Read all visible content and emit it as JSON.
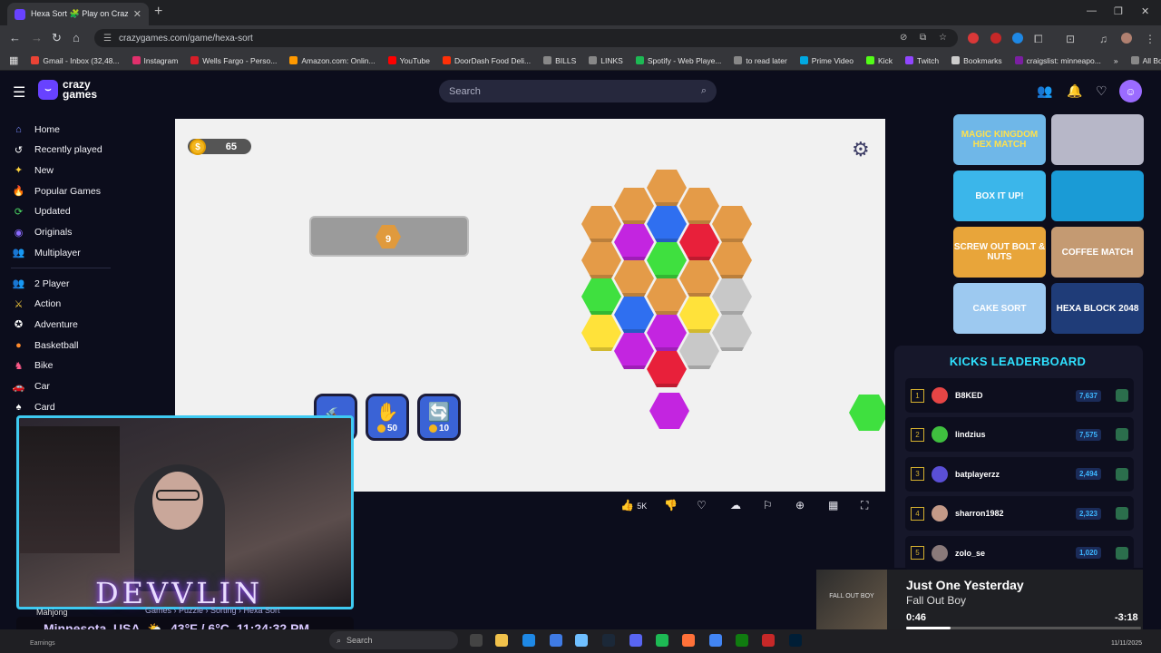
{
  "browser": {
    "tab_title": "Hexa Sort 🧩 Play on CrazyGames",
    "new_tab": "+",
    "url": "crazygames.com/game/hexa-sort",
    "bookmarks": [
      {
        "label": "Gmail - Inbox (32,48...",
        "color": "#ea4335"
      },
      {
        "label": "Instagram",
        "color": "#e1306c"
      },
      {
        "label": "Wells Fargo - Perso...",
        "color": "#d71e28"
      },
      {
        "label": "Amazon.com: Onlin...",
        "color": "#ff9900"
      },
      {
        "label": "YouTube",
        "color": "#ff0000"
      },
      {
        "label": "DoorDash Food Deli...",
        "color": "#ff3008"
      },
      {
        "label": "BILLS",
        "color": "#888888"
      },
      {
        "label": "LINKS",
        "color": "#888888"
      },
      {
        "label": "Spotify - Web Playe...",
        "color": "#1db954"
      },
      {
        "label": "to read later",
        "color": "#888888"
      },
      {
        "label": "Prime Video",
        "color": "#00a8e1"
      },
      {
        "label": "Kick",
        "color": "#53fc18"
      },
      {
        "label": "Twitch",
        "color": "#9146ff"
      },
      {
        "label": "Bookmarks",
        "color": "#cccccc"
      },
      {
        "label": "craigslist: minneapo...",
        "color": "#7b1fa2"
      }
    ],
    "all_bookmarks": "All Bookmarks"
  },
  "site": {
    "logo_icon": "⌣",
    "logo_line1": "crazy",
    "logo_line2": "games",
    "search_placeholder": "Search"
  },
  "sidebar": {
    "main": [
      {
        "label": "Home",
        "icon": "home-icon",
        "glyph": "⌂",
        "color": "#7a8cff"
      },
      {
        "label": "Recently played",
        "icon": "history-icon",
        "glyph": "↺",
        "color": "#ffffff"
      },
      {
        "label": "New",
        "icon": "sparkle-icon",
        "glyph": "✦",
        "color": "#ffd33d"
      },
      {
        "label": "Popular Games",
        "icon": "fire-icon",
        "glyph": "🔥",
        "color": "#ff6a2b"
      },
      {
        "label": "Updated",
        "icon": "refresh-icon",
        "glyph": "⟳",
        "color": "#4cd964"
      },
      {
        "label": "Originals",
        "icon": "originals-icon",
        "glyph": "◉",
        "color": "#8b6bff"
      },
      {
        "label": "Multiplayer",
        "icon": "multiplayer-icon",
        "glyph": "👥",
        "color": "#8b6bff"
      }
    ],
    "categories": [
      {
        "label": "2 Player",
        "icon": "two-player-icon",
        "glyph": "👥",
        "color": "#7a8cff"
      },
      {
        "label": "Action",
        "icon": "sword-icon",
        "glyph": "⚔",
        "color": "#ffd33d"
      },
      {
        "label": "Adventure",
        "icon": "compass-icon",
        "glyph": "✪",
        "color": "#ffffff"
      },
      {
        "label": "Basketball",
        "icon": "basketball-icon",
        "glyph": "●",
        "color": "#ff8a2b"
      },
      {
        "label": "Bike",
        "icon": "bike-icon",
        "glyph": "♞",
        "color": "#ff5a8a"
      },
      {
        "label": "Car",
        "icon": "car-icon",
        "glyph": "🚗",
        "color": "#ff4444"
      },
      {
        "label": "Card",
        "icon": "card-icon",
        "glyph": "♠",
        "color": "#ffffff"
      }
    ]
  },
  "game": {
    "coins": "65",
    "coin_symbol": "$",
    "unlock_count": "9",
    "boosters": [
      {
        "name": "hammer-booster",
        "icon": "🔨",
        "cost": "",
        "color": "#4a73e8"
      },
      {
        "name": "swap-booster",
        "icon": "✋",
        "cost": "50",
        "color": "#4a73e8"
      },
      {
        "name": "shuffle-booster",
        "icon": "🔄",
        "cost": "10",
        "color": "#4a73e8"
      }
    ]
  },
  "game_toolbar": {
    "likes": "5K"
  },
  "right_rail": {
    "thumbs": [
      {
        "label": "MAGIC KINGDOM HEX MATCH",
        "bg": "#6fb7e8",
        "fg": "#ffe14d"
      },
      {
        "label": "",
        "bg": "#b7b7c8",
        "fg": "#ffffff"
      },
      {
        "label": "BOX IT UP!",
        "bg": "#3bb6ea",
        "fg": "#ffffff"
      },
      {
        "label": "",
        "bg": "#1a9bd6",
        "fg": "#ffffff"
      },
      {
        "label": "SCREW OUT BOLT & NUTS",
        "bg": "#e8a53a",
        "fg": "#ffffff"
      },
      {
        "label": "COFFEE MATCH",
        "bg": "#c49a72",
        "fg": "#ffffff"
      },
      {
        "label": "CAKE SORT",
        "bg": "#9dc9f0",
        "fg": "#ffffff"
      },
      {
        "label": "HEXA BLOCK 2048",
        "bg": "#1f3c78",
        "fg": "#ffffff"
      }
    ]
  },
  "leaderboard": {
    "title": "KICKS LEADERBOARD",
    "rows": [
      {
        "rank": "1",
        "name": "B8KED",
        "score": "7,637",
        "avatar": "#e64545"
      },
      {
        "rank": "2",
        "name": "lindzius",
        "score": "7,575",
        "avatar": "#3fbf3f"
      },
      {
        "rank": "3",
        "name": "batplayerzz",
        "score": "2,494",
        "avatar": "#5a4fd6"
      },
      {
        "rank": "4",
        "name": "sharron1982",
        "score": "2,323",
        "avatar": "#c49a88"
      },
      {
        "rank": "5",
        "name": "zolo_se",
        "score": "1,020",
        "avatar": "#8a7a7a"
      }
    ]
  },
  "stream": {
    "name": "DEVVLIN",
    "breadcrumb": "Games › Puzzle › Sorting › Hexa Sort",
    "location": "Minnesota, USA",
    "weather_icon": "⛅",
    "temperature": "43°F / 6°C",
    "time": "11:24:32 PM",
    "game_label": "Mahjong"
  },
  "now_playing": {
    "title": "Just One Yesterday",
    "artist": "Fall Out Boy",
    "art_text": "FALL OUT BOY",
    "elapsed": "0:46",
    "remaining": "-3:18",
    "progress": 0.19
  },
  "taskbar": {
    "search_placeholder": "Search",
    "date": "11/11/2025",
    "left_label": "Earnings"
  }
}
